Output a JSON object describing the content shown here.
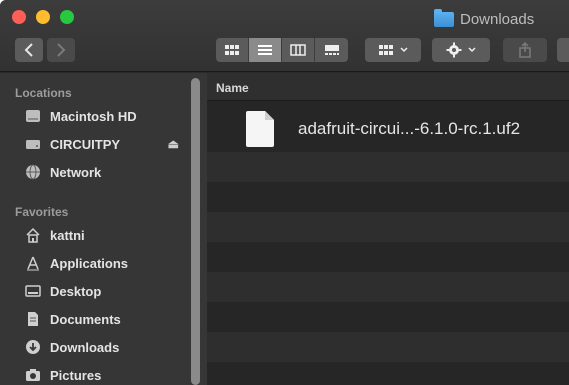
{
  "window": {
    "title": "Downloads"
  },
  "sidebar": {
    "sections": [
      {
        "title": "Locations",
        "items": [
          {
            "label": "Macintosh HD",
            "icon": "hard-drive-icon"
          },
          {
            "label": "CIRCUITPY",
            "icon": "drive-icon",
            "ejectable": true
          },
          {
            "label": "Network",
            "icon": "globe-icon"
          }
        ]
      },
      {
        "title": "Favorites",
        "items": [
          {
            "label": "kattni",
            "icon": "home-icon"
          },
          {
            "label": "Applications",
            "icon": "applications-icon"
          },
          {
            "label": "Desktop",
            "icon": "desktop-icon"
          },
          {
            "label": "Documents",
            "icon": "document-icon"
          },
          {
            "label": "Downloads",
            "icon": "download-icon"
          },
          {
            "label": "Pictures",
            "icon": "camera-icon"
          }
        ]
      }
    ]
  },
  "list": {
    "column_name": "Name",
    "files": [
      {
        "name": "adafruit-circui...-6.1.0-rc.1.uf2",
        "icon": "file-icon"
      }
    ]
  },
  "colors": {
    "accent": "#3d8fd4",
    "close": "#fd5f57",
    "minimize": "#febc2e",
    "zoom": "#28c840"
  }
}
